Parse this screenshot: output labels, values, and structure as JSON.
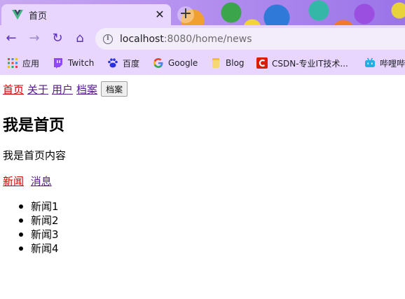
{
  "browser": {
    "tab": {
      "title": "首页",
      "close_glyph": "✕",
      "icon": "vue-logo-icon"
    },
    "new_tab_glyph": "+",
    "nav": {
      "back": "←",
      "forward": "→",
      "reload": "↻",
      "home": "⌂"
    },
    "url": {
      "host": "localhost",
      "path": ":8080/home/news"
    },
    "bookmarks": [
      {
        "label": "应用",
        "icon": "apps-grid-icon"
      },
      {
        "label": "Twitch",
        "icon": "twitch-icon"
      },
      {
        "label": "百度",
        "icon": "baidu-paw-icon"
      },
      {
        "label": "Google",
        "icon": "google-icon"
      },
      {
        "label": "Blog",
        "icon": "folder-icon"
      },
      {
        "label": "CSDN-专业IT技术...",
        "icon": "csdn-icon"
      },
      {
        "label": "哔哩哔",
        "icon": "bilibili-icon"
      }
    ],
    "accent_color": "#e9d6ff"
  },
  "page": {
    "nav": [
      {
        "label": "首页",
        "active": true
      },
      {
        "label": "关于",
        "active": false
      },
      {
        "label": "用户",
        "active": false
      },
      {
        "label": "档案",
        "active": false
      }
    ],
    "archive_button": "档案",
    "title": "我是首页",
    "body": "我是首页内容",
    "subnav": [
      {
        "label": "新闻",
        "active": true
      },
      {
        "label": "消息",
        "active": false
      }
    ],
    "news": [
      "新闻1",
      "新闻2",
      "新闻3",
      "新闻4"
    ]
  }
}
